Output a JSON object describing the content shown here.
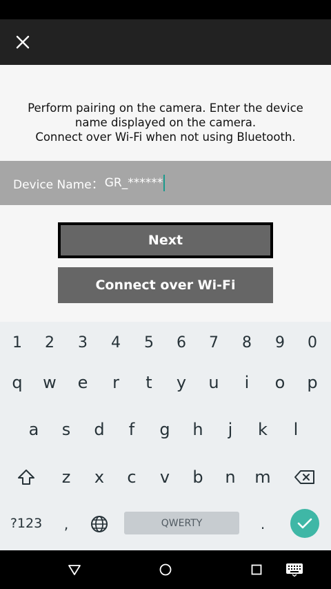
{
  "header": {
    "close_icon": "close-icon"
  },
  "instructions": {
    "line1": "Perform pairing on the camera. Enter the device",
    "line2": "name displayed on the camera.",
    "line3": "Connect over Wi-Fi when not using Bluetooth."
  },
  "device": {
    "label": "Device Name：",
    "value": "GR_******"
  },
  "buttons": {
    "next": "Next",
    "wifi": "Connect over Wi-Fi"
  },
  "keyboard": {
    "row_numbers": [
      "1",
      "2",
      "3",
      "4",
      "5",
      "6",
      "7",
      "8",
      "9",
      "0"
    ],
    "row1": [
      "q",
      "w",
      "e",
      "r",
      "t",
      "y",
      "u",
      "i",
      "o",
      "p"
    ],
    "row2": [
      "a",
      "s",
      "d",
      "f",
      "g",
      "h",
      "j",
      "k",
      "l"
    ],
    "row3": [
      "z",
      "x",
      "c",
      "v",
      "b",
      "n",
      "m"
    ],
    "symbols_label": "?123",
    "comma": ",",
    "period": ".",
    "space_label": "QWERTY",
    "shift_icon": "shift-icon",
    "backspace_icon": "backspace-icon",
    "globe_icon": "globe-icon",
    "enter_icon": "checkmark-icon"
  },
  "nav": {
    "back_icon": "back-triangle-icon",
    "home_icon": "home-circle-icon",
    "recents_icon": "recents-square-icon",
    "keyboard_icon": "keyboard-icon"
  },
  "colors": {
    "accent": "#3fb7a6",
    "button": "#666666",
    "device_row": "#a6a6a6",
    "app_bar": "#222222"
  }
}
